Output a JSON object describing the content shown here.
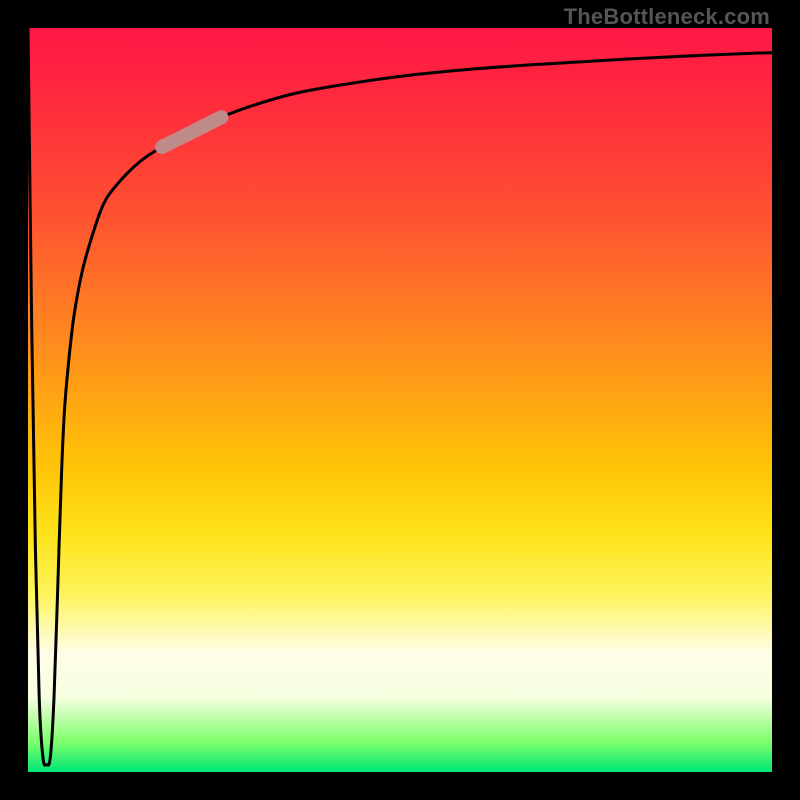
{
  "watermark": "TheBottleneck.com",
  "chart_data": {
    "type": "line",
    "title": "",
    "xlabel": "",
    "ylabel": "",
    "xlim": [
      0,
      100
    ],
    "ylim": [
      0,
      100
    ],
    "grid": false,
    "legend": false,
    "background_gradient": [
      {
        "pos": 0,
        "color": "#ff1744"
      },
      {
        "pos": 25,
        "color": "#ff5131"
      },
      {
        "pos": 50,
        "color": "#ffb300"
      },
      {
        "pos": 70,
        "color": "#ffe31a"
      },
      {
        "pos": 85,
        "color": "#fffde7"
      },
      {
        "pos": 100,
        "color": "#00e676"
      }
    ],
    "series": [
      {
        "name": "bottleneck-curve",
        "color": "#000000",
        "x": [
          0,
          0.5,
          1,
          1.5,
          2,
          2.5,
          3,
          3.5,
          4,
          4.5,
          5,
          6,
          7,
          8,
          10,
          12,
          15,
          18,
          22,
          26,
          30,
          35,
          40,
          50,
          60,
          70,
          80,
          90,
          100
        ],
        "y": [
          100,
          60,
          30,
          10,
          2,
          1,
          2,
          10,
          25,
          40,
          50,
          60,
          66,
          70,
          76,
          79,
          82,
          84,
          86,
          88,
          89.5,
          91,
          92,
          93.5,
          94.5,
          95.2,
          95.8,
          96.3,
          96.7
        ]
      }
    ],
    "highlight_segment": {
      "series": "bottleneck-curve",
      "x_start": 18,
      "x_end": 26,
      "color": "#c08a8a",
      "width": 14
    }
  }
}
